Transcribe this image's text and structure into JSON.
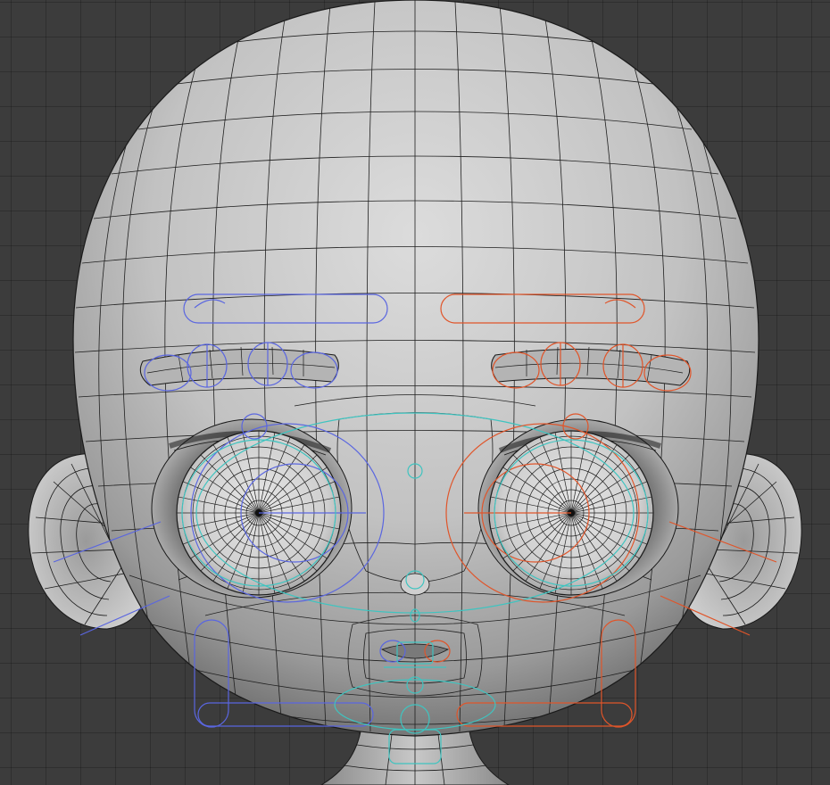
{
  "viewport": {
    "background_color": "#3c3c3c",
    "grid_color": "#2a2a2a",
    "mesh_wire_color": "#1a1a1a",
    "mesh_face_light": "#d6d6d6",
    "mesh_face_dark": "#6e6e6e"
  },
  "model": {
    "parts": [
      "head",
      "left-ear",
      "right-ear",
      "left-eye",
      "right-eye",
      "left-eyebrow",
      "right-eyebrow",
      "nose",
      "mouth",
      "neck"
    ]
  },
  "rig_controls": {
    "left_side_color": "#5a66e0",
    "right_side_color": "#e0552a",
    "center_color": "#3fc4c0",
    "items": [
      "left-brow-bar-control",
      "right-brow-bar-control",
      "left-brow-controls",
      "right-brow-controls",
      "left-eye-control",
      "right-eye-control",
      "face-center-control",
      "nose-control",
      "mouth-controls",
      "left-cheek-control",
      "right-cheek-control",
      "jaw-control",
      "neck-control"
    ]
  }
}
